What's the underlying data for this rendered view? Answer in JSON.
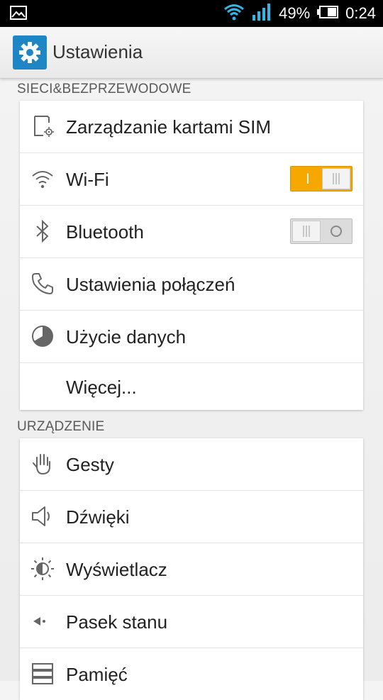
{
  "status_bar": {
    "battery_percent": "49%",
    "time": "0:24",
    "icons": [
      "image-icon",
      "wifi-icon",
      "signal-icon",
      "battery-icon"
    ]
  },
  "app": {
    "title": "Ustawienia",
    "icon": "gear-icon",
    "icon_color": "#1f86c5"
  },
  "sections": [
    {
      "header": "SIECI&BEZPRZEWODOWE",
      "items": [
        {
          "label": "Zarządzanie kartami SIM",
          "icon": "sim-settings-icon"
        },
        {
          "label": "Wi-Fi",
          "icon": "wifi-icon",
          "toggle": "on",
          "toggle_mark": "I"
        },
        {
          "label": "Bluetooth",
          "icon": "bluetooth-icon",
          "toggle": "off",
          "toggle_mark": "O"
        },
        {
          "label": "Ustawienia połączeń",
          "icon": "phone-icon"
        },
        {
          "label": "Użycie danych",
          "icon": "data-usage-icon"
        },
        {
          "label": "Więcej...",
          "icon": ""
        }
      ]
    },
    {
      "header": "URZĄDZENIE",
      "items": [
        {
          "label": "Gesty",
          "icon": "hand-icon"
        },
        {
          "label": "Dźwięki",
          "icon": "speaker-icon"
        },
        {
          "label": "Wyświetlacz",
          "icon": "brightness-icon"
        },
        {
          "label": "Pasek stanu",
          "icon": "status-bar-icon"
        },
        {
          "label": "Pamięć",
          "icon": "storage-icon"
        }
      ]
    }
  ],
  "colors": {
    "toggle_on": "#f6a800",
    "toggle_off": "#dcdcdc",
    "accent": "#1f86c5"
  }
}
